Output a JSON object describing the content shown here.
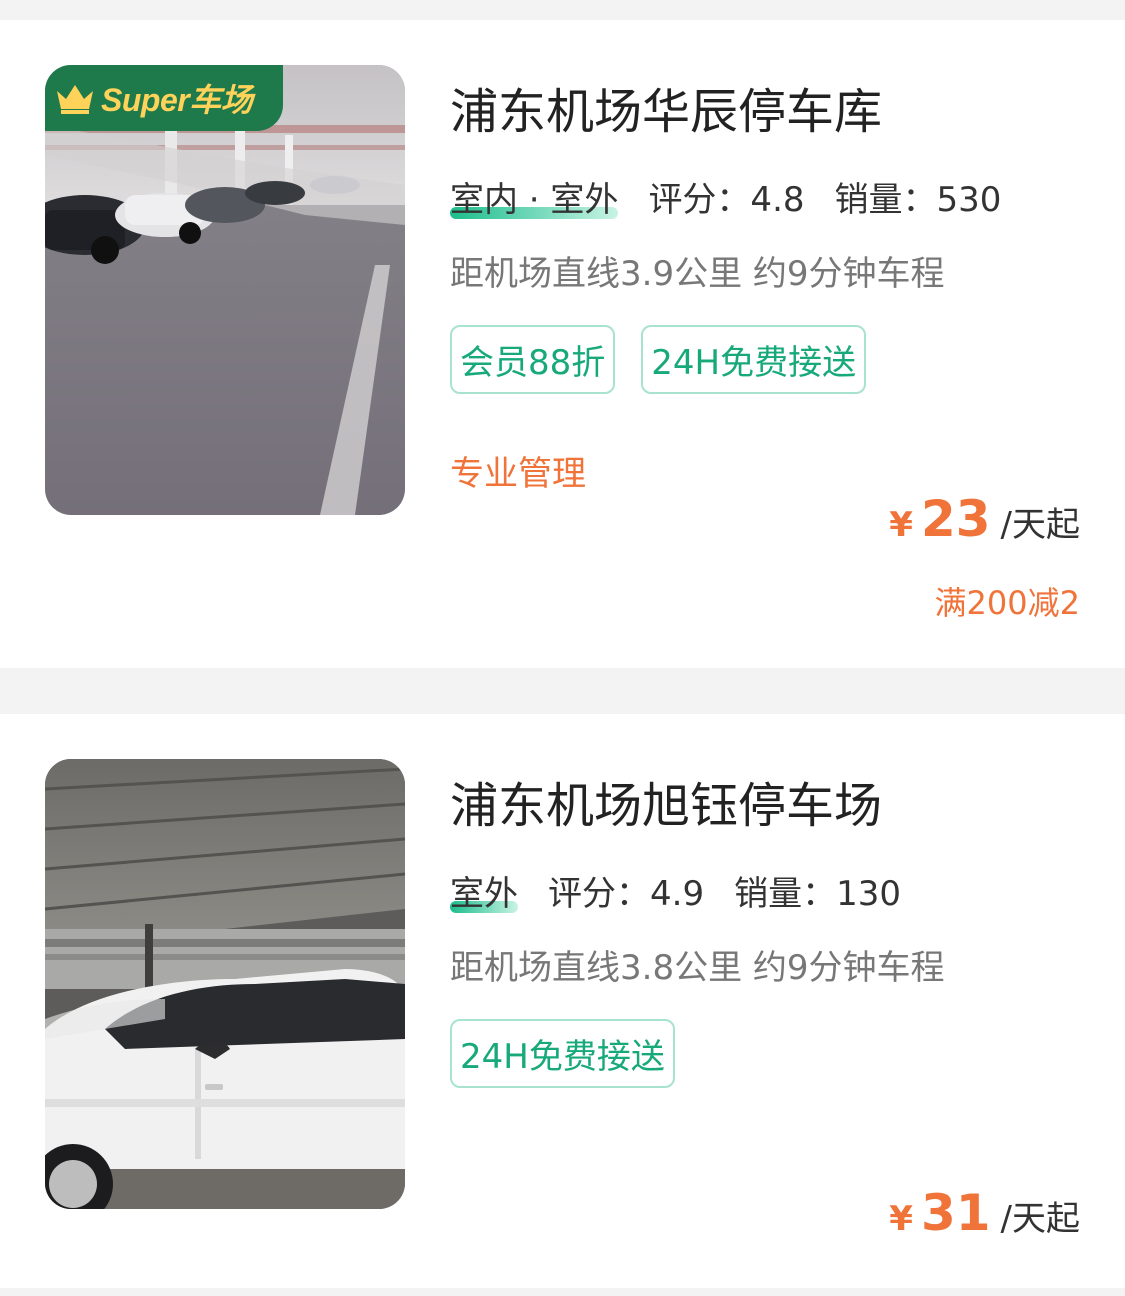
{
  "lots": [
    {
      "name": "浦东机场华辰停车库",
      "type": "室内 · 室外",
      "rating": "评分：4.8",
      "sales": "销量：530",
      "distance": "距机场直线3.9公里 约9分钟车程",
      "tags": [
        "会员88折",
        "24H免费接送"
      ],
      "feature": "专业管理",
      "badge": "Super车场",
      "price_symbol": "¥",
      "price": "23",
      "price_unit": "/天起",
      "discount": "满200减2"
    },
    {
      "name": "浦东机场旭钰停车场",
      "type": "室外",
      "rating": "评分：4.9",
      "sales": "销量：130",
      "distance": "距机场直线3.8公里 约9分钟车程",
      "tags": [
        "24H免费接送"
      ],
      "price_symbol": "¥",
      "price": "31",
      "price_unit": "/天起"
    }
  ],
  "colors": {
    "accent_orange": "#f0733a",
    "tag_green": "#18a97b",
    "badge_green": "#1f7a4b",
    "badge_text": "#ffd25a"
  }
}
